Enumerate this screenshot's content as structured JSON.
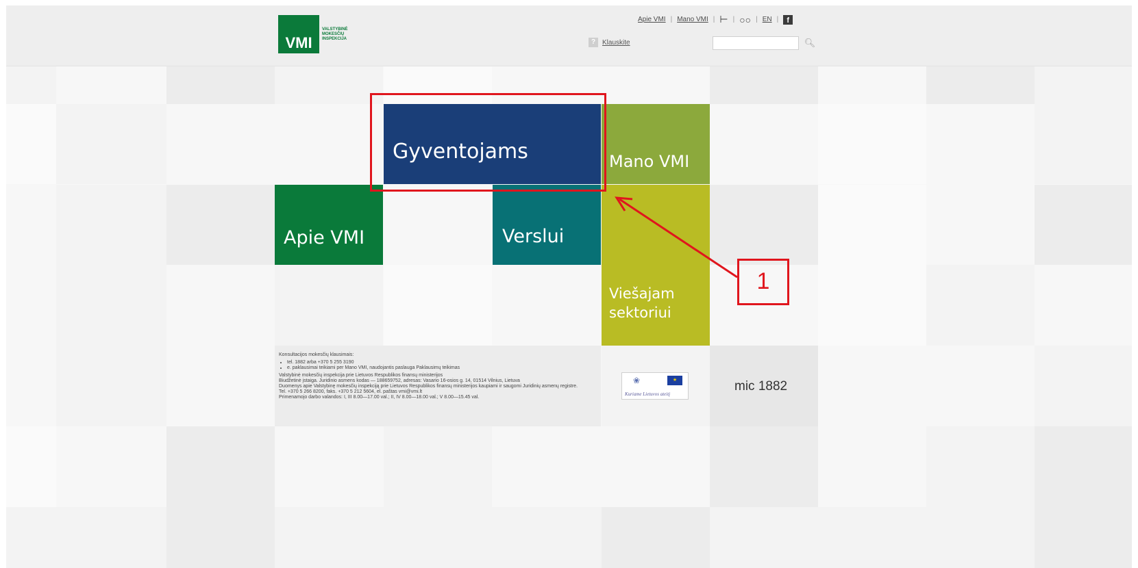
{
  "header": {
    "logo": {
      "abbr": "VMI",
      "line1": "VALSTYBINĖ",
      "line2": "MOKESČIŲ",
      "line3": "INSPEKCIJA"
    },
    "links": {
      "apie": "Apie VMI",
      "mano": "Mano VMI",
      "en": "EN"
    },
    "icons": {
      "sitemap": "sitemap-icon",
      "glasses": "low-vision-icon",
      "facebook": "facebook-icon"
    },
    "help": {
      "icon": "?",
      "label": "Klauskite"
    },
    "search": {
      "value": "",
      "placeholder": ""
    }
  },
  "tiles": {
    "gyventojams": "Gyventojams",
    "mano_vmi": "Mano VMI",
    "apie_vmi": "Apie VMI",
    "verslui": "Verslui",
    "viesajam": "Viešajam sektoriui"
  },
  "footer": {
    "intro": "Konsultacijos mokesčių klausimais:",
    "item1": "tel. 1882 arba +370 5 255 3190",
    "item2": "e. paklausimai teikiami per Mano VMI, naudojantis paslauga Paklausimų teikimas",
    "line1": "Valstybinė mokesčių inspekcija prie Lietuvos Respublikos finansų ministerijos",
    "line2": "Biudžetinė įstaiga. Juridinio asmens kodas — 188659752, adresas: Vasario 16-osios g. 14, 01514 Vilnius, Lietuva",
    "line3": "Duomenys apie Valstybinę mokesčių inspekciją prie Lietuvos Respublikos finansų ministerijos kaupiami ir saugomi Juridinių asmenų registre.",
    "line4": "Tel. +370 5 266 8200, faks. +370 5 212 5604, el. paštas vmi@vmi.lt",
    "line5": "Primenamojo darbo valandos: I, III 8.00—17.00 val.; II, IV 8.00—18.00 val.; V 8.00—15.45 val."
  },
  "partners": {
    "eu_caption": "Kuriame Lietuvos ateitį",
    "mic": "mic 1882"
  },
  "annotation": {
    "number": "1"
  },
  "colors": {
    "gyventojams": "#1a3e78",
    "mano_vmi": "#8ca93c",
    "apie_vmi": "#0a7a3a",
    "verslui": "#087175",
    "viesajam": "#b9bc24",
    "annotation": "#e0151d"
  }
}
